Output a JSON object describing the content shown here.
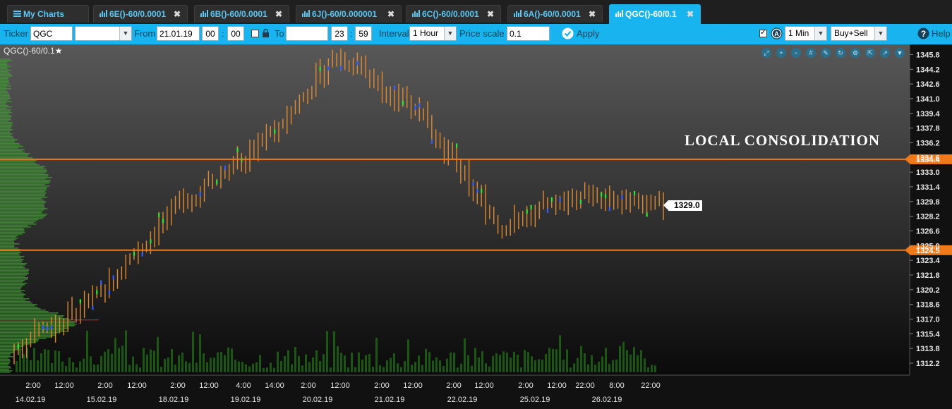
{
  "tabs": [
    {
      "label": "My Charts",
      "icon": "menu-icon",
      "close": "",
      "active": false
    },
    {
      "label": "6E()-60/0.0001",
      "icon": "chart-icon",
      "close": "✖",
      "active": false
    },
    {
      "label": "6B()-60/0.0001",
      "icon": "chart-icon",
      "close": "✖",
      "active": false
    },
    {
      "label": "6J()-60/0.000001",
      "icon": "chart-icon",
      "close": "✖",
      "active": false
    },
    {
      "label": "6C()-60/0.0001",
      "icon": "chart-icon",
      "close": "✖",
      "active": false
    },
    {
      "label": "6A()-60/0.0001",
      "icon": "chart-icon",
      "close": "✖",
      "active": false
    },
    {
      "label": "QGC()-60/0.1",
      "icon": "chart-icon",
      "close": "✖",
      "active": true
    }
  ],
  "toolbar": {
    "ticker_label": "Ticker",
    "ticker_value": "QGC",
    "ticker_select_value": "",
    "from_label": "From",
    "from_date": "21.01.19",
    "from_hour": "00",
    "from_sep": ":",
    "from_min": "00",
    "to_label": "To",
    "to_date": "",
    "to_hour": "23",
    "to_sep": ":",
    "to_min": "59",
    "interval_label": "Interval",
    "interval_value": "1 Hour",
    "price_scale_label": "Price scale",
    "price_scale_value": "0.1",
    "apply_label": "Apply",
    "period_value": "1 Min",
    "side_value": "Buy+Sell",
    "help_label": "Help"
  },
  "chart": {
    "title": "QGC()-60/0.1",
    "star": "★",
    "annotation": "LOCAL CONSOLIDATION",
    "current_price": "1329.0",
    "level_upper": "1334.4",
    "level_lower": "1324.5",
    "price_ticks": [
      "1345.8",
      "1344.2",
      "1342.6",
      "1341.0",
      "1339.4",
      "1337.8",
      "1336.2",
      "1334.6",
      "1333.0",
      "1331.4",
      "1329.8",
      "1328.2",
      "1326.6",
      "1325.0",
      "1323.4",
      "1321.8",
      "1320.2",
      "1318.6",
      "1317.0",
      "1315.4",
      "1313.8",
      "1312.2"
    ],
    "time_ticks": [
      "2:00",
      "12:00",
      "2:00",
      "12:00",
      "2:00",
      "12:00",
      "4:00",
      "14:00",
      "2:00",
      "12:00",
      "2:00",
      "12:00",
      "2:00",
      "12:00",
      "2:00",
      "12:00",
      "22:00",
      "8:00",
      "22:00"
    ],
    "date_ticks": [
      "14.02.19",
      "15.02.19",
      "18.02.19",
      "19.02.19",
      "20.02.19",
      "21.02.19",
      "22.02.19",
      "25.02.19",
      "26.02.19"
    ],
    "icons": [
      "zoom-fit-icon",
      "zoom-in-icon",
      "zoom-out-icon",
      "grid-icon",
      "pencil-icon",
      "refresh-icon",
      "settings-icon",
      "export-icon",
      "share-icon",
      "dropdown-icon"
    ],
    "colors": {
      "bar": "#e08a30",
      "level": "#f07a1a",
      "buy": "#2ee62e",
      "sell": "#3a5cff",
      "profile": "#2faa1e",
      "volume": "#1f6a14"
    }
  },
  "chart_data": {
    "type": "bar",
    "title": "QGC()-60/0.1",
    "ylim": [
      1311.2,
      1346.6
    ],
    "horizontal_levels": [
      1334.4,
      1324.5
    ],
    "last_price": 1329.0,
    "sessions": [
      "14.02.19",
      "15.02.19",
      "18.02.19",
      "19.02.19",
      "20.02.19",
      "21.02.19",
      "22.02.19",
      "25.02.19",
      "26.02.19"
    ],
    "session_closes": [
      1313.5,
      1319.5,
      1329.0,
      1335.5,
      1345.8,
      1339.5,
      1327.0,
      1330.5,
      1329.0
    ]
  }
}
